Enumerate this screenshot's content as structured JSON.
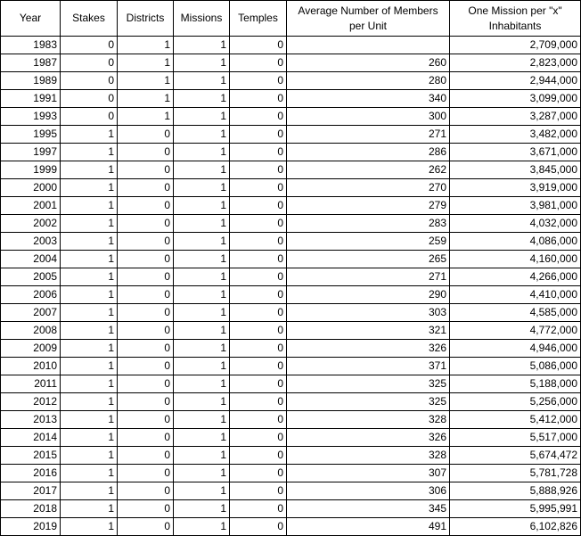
{
  "headers": [
    "Year",
    "Stakes",
    "Districts",
    "Missions",
    "Temples",
    "Average Number of Members per Unit",
    "One Mission per \"x\" Inhabitants"
  ],
  "rows": [
    [
      "1983",
      "0",
      "1",
      "1",
      "0",
      "",
      "2,709,000"
    ],
    [
      "1987",
      "0",
      "1",
      "1",
      "0",
      "260",
      "2,823,000"
    ],
    [
      "1989",
      "0",
      "1",
      "1",
      "0",
      "280",
      "2,944,000"
    ],
    [
      "1991",
      "0",
      "1",
      "1",
      "0",
      "340",
      "3,099,000"
    ],
    [
      "1993",
      "0",
      "1",
      "1",
      "0",
      "300",
      "3,287,000"
    ],
    [
      "1995",
      "1",
      "0",
      "1",
      "0",
      "271",
      "3,482,000"
    ],
    [
      "1997",
      "1",
      "0",
      "1",
      "0",
      "286",
      "3,671,000"
    ],
    [
      "1999",
      "1",
      "0",
      "1",
      "0",
      "262",
      "3,845,000"
    ],
    [
      "2000",
      "1",
      "0",
      "1",
      "0",
      "270",
      "3,919,000"
    ],
    [
      "2001",
      "1",
      "0",
      "1",
      "0",
      "279",
      "3,981,000"
    ],
    [
      "2002",
      "1",
      "0",
      "1",
      "0",
      "283",
      "4,032,000"
    ],
    [
      "2003",
      "1",
      "0",
      "1",
      "0",
      "259",
      "4,086,000"
    ],
    [
      "2004",
      "1",
      "0",
      "1",
      "0",
      "265",
      "4,160,000"
    ],
    [
      "2005",
      "1",
      "0",
      "1",
      "0",
      "271",
      "4,266,000"
    ],
    [
      "2006",
      "1",
      "0",
      "1",
      "0",
      "290",
      "4,410,000"
    ],
    [
      "2007",
      "1",
      "0",
      "1",
      "0",
      "303",
      "4,585,000"
    ],
    [
      "2008",
      "1",
      "0",
      "1",
      "0",
      "321",
      "4,772,000"
    ],
    [
      "2009",
      "1",
      "0",
      "1",
      "0",
      "326",
      "4,946,000"
    ],
    [
      "2010",
      "1",
      "0",
      "1",
      "0",
      "371",
      "5,086,000"
    ],
    [
      "2011",
      "1",
      "0",
      "1",
      "0",
      "325",
      "5,188,000"
    ],
    [
      "2012",
      "1",
      "0",
      "1",
      "0",
      "325",
      "5,256,000"
    ],
    [
      "2013",
      "1",
      "0",
      "1",
      "0",
      "328",
      "5,412,000"
    ],
    [
      "2014",
      "1",
      "0",
      "1",
      "0",
      "326",
      "5,517,000"
    ],
    [
      "2015",
      "1",
      "0",
      "1",
      "0",
      "328",
      "5,674,472"
    ],
    [
      "2016",
      "1",
      "0",
      "1",
      "0",
      "307",
      "5,781,728"
    ],
    [
      "2017",
      "1",
      "0",
      "1",
      "0",
      "306",
      "5,888,926"
    ],
    [
      "2018",
      "1",
      "0",
      "1",
      "0",
      "345",
      "5,995,991"
    ],
    [
      "2019",
      "1",
      "0",
      "1",
      "0",
      "491",
      "6,102,826"
    ]
  ]
}
